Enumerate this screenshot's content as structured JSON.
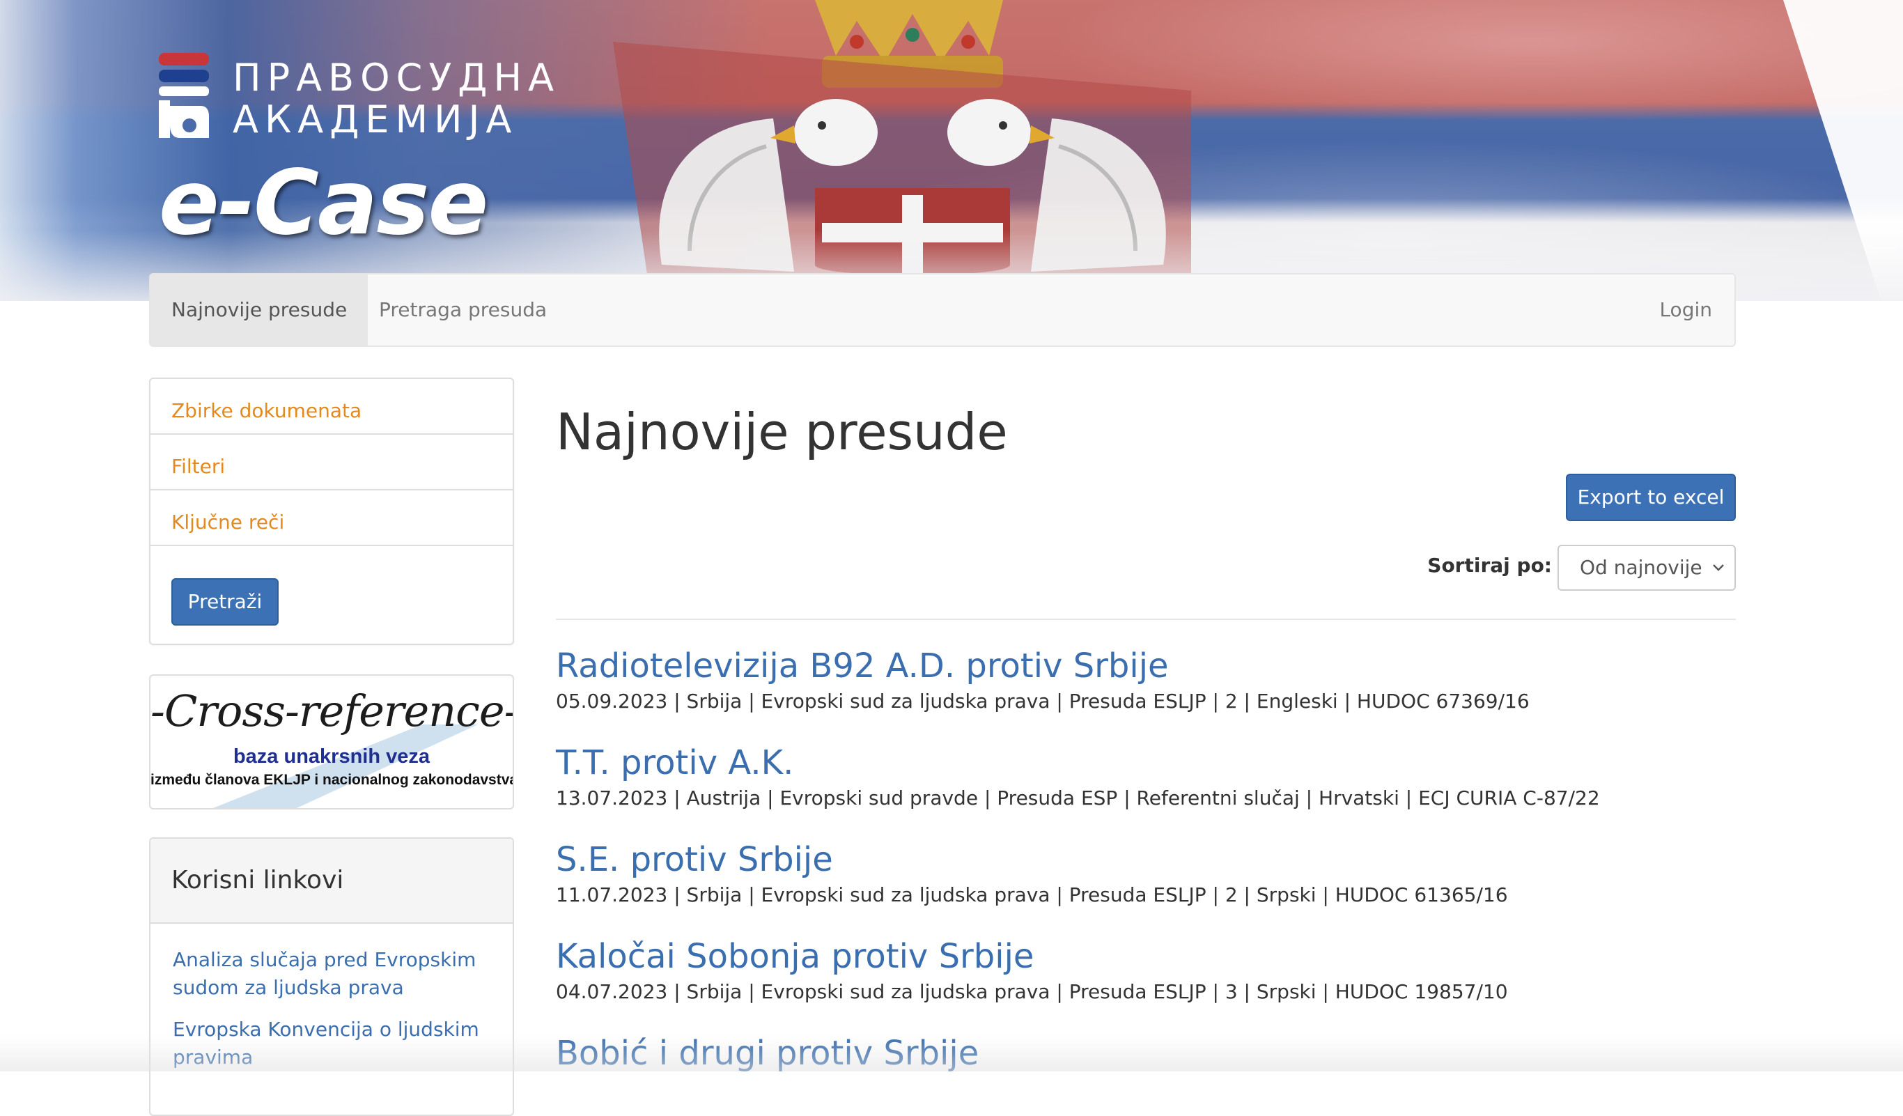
{
  "header": {
    "logo_line1": "ПРАВОСУДНА",
    "logo_line2": "АКАДЕМИЈА",
    "app_title": "e-Case"
  },
  "nav": {
    "items": [
      {
        "label": "Najnovije presude",
        "active": true
      },
      {
        "label": "Pretraga presuda",
        "active": false
      }
    ],
    "login": "Login"
  },
  "sidebar": {
    "filters": [
      {
        "label": "Zbirke dokumenata"
      },
      {
        "label": "Filteri"
      },
      {
        "label": "Ključne reči"
      }
    ],
    "search_button": "Pretraži",
    "crossref": {
      "title": "-Cross-reference-",
      "subtitle": "baza unakrsnih veza",
      "small": "između članova EKLJP i nacionalnog zakonodavstva"
    },
    "useful_links": {
      "heading": "Korisni linkovi",
      "items": [
        {
          "label": "Analiza slučaja pred Evropskim sudom za ljudska prava"
        },
        {
          "label": "Evropska Konvencija o ljudskim pravima"
        }
      ]
    }
  },
  "main": {
    "title": "Najnovije presude",
    "export_button": "Export to excel",
    "sort_label": "Sortiraj po:",
    "sort_value": "Od najnovije",
    "cases": [
      {
        "title": "Radiotelevizija B92 A.D. protiv Srbije",
        "meta": "05.09.2023 | Srbija | Evropski sud za ljudska prava | Presuda ESLJP | 2 | Engleski | HUDOC 67369/16"
      },
      {
        "title": "T.T. protiv A.K.",
        "meta": "13.07.2023 | Austrija | Evropski sud pravde | Presuda ESP | Referentni slučaj | Hrvatski | ECJ CURIA C-87/22"
      },
      {
        "title": "S.E. protiv Srbije",
        "meta": "11.07.2023 | Srbija | Evropski sud za ljudska prava | Presuda ESLJP | 2 | Srpski | HUDOC 61365/16"
      },
      {
        "title": "Kaločai Sobonja protiv Srbije",
        "meta": "04.07.2023 | Srbija | Evropski sud za ljudska prava | Presuda ESLJP | 3 | Srpski | HUDOC 19857/10"
      },
      {
        "title": "Bobić i drugi protiv Srbije",
        "meta": ""
      }
    ]
  },
  "colors": {
    "link_blue": "#3a6eae",
    "accent_orange": "#e4891d",
    "button_blue": "#3c72b5"
  },
  "icons": {
    "logo": "pravosudna-akademija-logo-icon",
    "coat_of_arms": "serbian-coat-of-arms-icon",
    "select": "chevron-down-icon"
  }
}
